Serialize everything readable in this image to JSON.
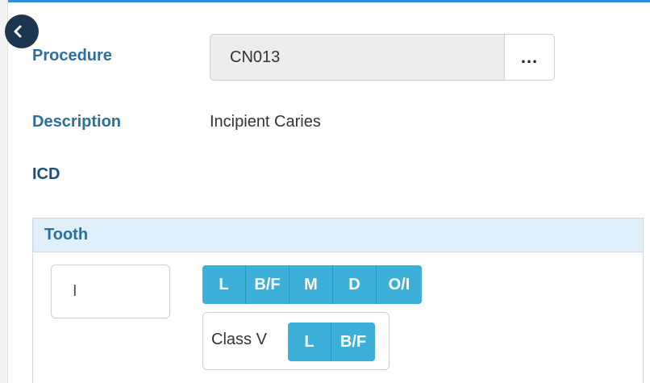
{
  "form": {
    "procedure_label": "Procedure",
    "procedure_value": "CN013",
    "procedure_lookup_label": "...",
    "description_label": "Description",
    "description_value": "Incipient Caries",
    "icd_label": "ICD"
  },
  "tooth": {
    "header": "Tooth",
    "tooth_value": "I",
    "surfaces": [
      "L",
      "B/F",
      "M",
      "D",
      "O/I"
    ],
    "class_label": "Class V",
    "class_surfaces": [
      "L",
      "B/F"
    ]
  },
  "colors": {
    "accent": "#3cb0d8",
    "label_blue": "#2a6f9e",
    "header_bg": "#dff0fb",
    "back_button": "#1c3550"
  },
  "icons": {
    "back": "chevron-left-icon"
  }
}
